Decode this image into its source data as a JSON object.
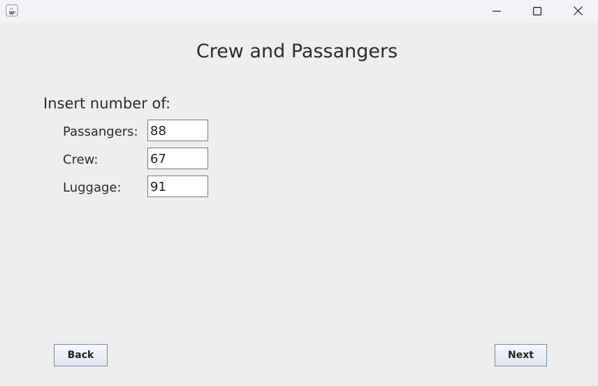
{
  "window": {
    "icon": "java-cup-icon",
    "controls": [
      "minimize-icon",
      "maximize-icon",
      "close-icon"
    ]
  },
  "heading": "Crew and Passangers",
  "prompt": "Insert number of:",
  "fields": [
    {
      "label": "Passangers:",
      "value": "88"
    },
    {
      "label": "Crew:",
      "value": "67"
    },
    {
      "label": "Luggage:",
      "value": "91"
    }
  ],
  "buttons": {
    "back": "Back",
    "next": "Next"
  }
}
